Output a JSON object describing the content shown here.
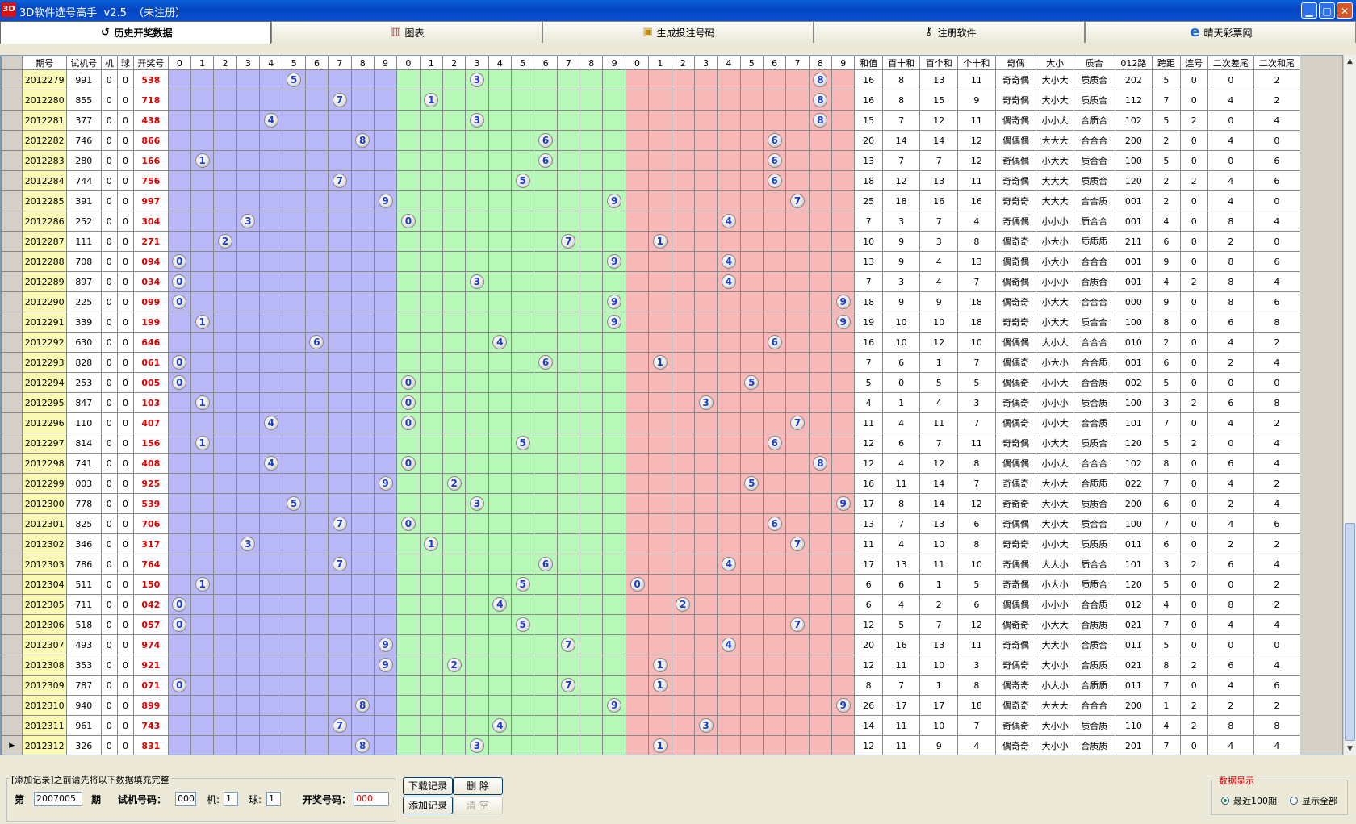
{
  "window": {
    "app_icon": "3D",
    "title": "3D软件选号高手  v2.5  （未注册）",
    "minimize": "▁",
    "maximize": "□",
    "close": "✕"
  },
  "tabs": [
    {
      "label": "历史开奖数据",
      "icon": "history-icon",
      "glyph": "↺"
    },
    {
      "label": "图表",
      "icon": "chart-icon",
      "glyph": "▥"
    },
    {
      "label": "生成投注号码",
      "icon": "ticket-icon",
      "glyph": "▣"
    },
    {
      "label": "注册软件",
      "icon": "key-icon",
      "glyph": "⚷"
    },
    {
      "label": "晴天彩票网",
      "icon": "ie-icon",
      "glyph": "e"
    }
  ],
  "columns": [
    "期号",
    "试机号",
    "机",
    "球",
    "开奖号",
    "0",
    "1",
    "2",
    "3",
    "4",
    "5",
    "6",
    "7",
    "8",
    "9",
    "0",
    "1",
    "2",
    "3",
    "4",
    "5",
    "6",
    "7",
    "8",
    "9",
    "0",
    "1",
    "2",
    "3",
    "4",
    "5",
    "6",
    "7",
    "8",
    "9",
    "和值",
    "百十和",
    "百个和",
    "个十和",
    "奇偶",
    "大小",
    "质合",
    "012路",
    "跨距",
    "连号",
    "二次差尾",
    "二次和尾"
  ],
  "rows": [
    [
      "2012279",
      "991",
      "0",
      "0",
      "538",
      "16",
      "8",
      "13",
      "11",
      "奇奇偶",
      "大小大",
      "质质合",
      "202",
      "5",
      "0",
      "0",
      "2"
    ],
    [
      "2012280",
      "855",
      "0",
      "0",
      "718",
      "16",
      "8",
      "15",
      "9",
      "奇奇偶",
      "大小大",
      "质质合",
      "112",
      "7",
      "0",
      "4",
      "2"
    ],
    [
      "2012281",
      "377",
      "0",
      "0",
      "438",
      "15",
      "7",
      "12",
      "11",
      "偶奇偶",
      "小小大",
      "合质合",
      "102",
      "5",
      "2",
      "0",
      "4"
    ],
    [
      "2012282",
      "746",
      "0",
      "0",
      "866",
      "20",
      "14",
      "14",
      "12",
      "偶偶偶",
      "大大大",
      "合合合",
      "200",
      "2",
      "0",
      "4",
      "0"
    ],
    [
      "2012283",
      "280",
      "0",
      "0",
      "166",
      "13",
      "7",
      "7",
      "12",
      "奇偶偶",
      "小大大",
      "质合合",
      "100",
      "5",
      "0",
      "0",
      "6"
    ],
    [
      "2012284",
      "744",
      "0",
      "0",
      "756",
      "18",
      "12",
      "13",
      "11",
      "奇奇偶",
      "大大大",
      "质质合",
      "120",
      "2",
      "2",
      "4",
      "6"
    ],
    [
      "2012285",
      "391",
      "0",
      "0",
      "997",
      "25",
      "18",
      "16",
      "16",
      "奇奇奇",
      "大大大",
      "合合质",
      "001",
      "2",
      "0",
      "4",
      "0"
    ],
    [
      "2012286",
      "252",
      "0",
      "0",
      "304",
      "7",
      "3",
      "7",
      "4",
      "奇偶偶",
      "小小小",
      "质合合",
      "001",
      "4",
      "0",
      "8",
      "4"
    ],
    [
      "2012287",
      "111",
      "0",
      "0",
      "271",
      "10",
      "9",
      "3",
      "8",
      "偶奇奇",
      "小大小",
      "质质质",
      "211",
      "6",
      "0",
      "2",
      "0"
    ],
    [
      "2012288",
      "708",
      "0",
      "0",
      "094",
      "13",
      "9",
      "4",
      "13",
      "偶奇偶",
      "小大小",
      "合合合",
      "001",
      "9",
      "0",
      "8",
      "6"
    ],
    [
      "2012289",
      "897",
      "0",
      "0",
      "034",
      "7",
      "3",
      "4",
      "7",
      "偶奇偶",
      "小小小",
      "合质合",
      "001",
      "4",
      "2",
      "8",
      "4"
    ],
    [
      "2012290",
      "225",
      "0",
      "0",
      "099",
      "18",
      "9",
      "9",
      "18",
      "偶奇奇",
      "小大大",
      "合合合",
      "000",
      "9",
      "0",
      "8",
      "6"
    ],
    [
      "2012291",
      "339",
      "0",
      "0",
      "199",
      "19",
      "10",
      "10",
      "18",
      "奇奇奇",
      "小大大",
      "质合合",
      "100",
      "8",
      "0",
      "6",
      "8"
    ],
    [
      "2012292",
      "630",
      "0",
      "0",
      "646",
      "16",
      "10",
      "12",
      "10",
      "偶偶偶",
      "大小大",
      "合合合",
      "010",
      "2",
      "0",
      "4",
      "2"
    ],
    [
      "2012293",
      "828",
      "0",
      "0",
      "061",
      "7",
      "6",
      "1",
      "7",
      "偶偶奇",
      "小大小",
      "合合质",
      "001",
      "6",
      "0",
      "2",
      "4"
    ],
    [
      "2012294",
      "253",
      "0",
      "0",
      "005",
      "5",
      "0",
      "5",
      "5",
      "偶偶奇",
      "小小大",
      "合合质",
      "002",
      "5",
      "0",
      "0",
      "0"
    ],
    [
      "2012295",
      "847",
      "0",
      "0",
      "103",
      "4",
      "1",
      "4",
      "3",
      "奇偶奇",
      "小小小",
      "质合质",
      "100",
      "3",
      "2",
      "6",
      "8"
    ],
    [
      "2012296",
      "110",
      "0",
      "0",
      "407",
      "11",
      "4",
      "11",
      "7",
      "偶偶奇",
      "小小大",
      "合合质",
      "101",
      "7",
      "0",
      "4",
      "2"
    ],
    [
      "2012297",
      "814",
      "0",
      "0",
      "156",
      "12",
      "6",
      "7",
      "11",
      "奇奇偶",
      "小大大",
      "质质合",
      "120",
      "5",
      "2",
      "0",
      "4"
    ],
    [
      "2012298",
      "741",
      "0",
      "0",
      "408",
      "12",
      "4",
      "12",
      "8",
      "偶偶偶",
      "小小大",
      "合合合",
      "102",
      "8",
      "0",
      "6",
      "4"
    ],
    [
      "2012299",
      "003",
      "0",
      "0",
      "925",
      "16",
      "11",
      "14",
      "7",
      "奇偶奇",
      "大小大",
      "合质质",
      "022",
      "7",
      "0",
      "4",
      "2"
    ],
    [
      "2012300",
      "778",
      "0",
      "0",
      "539",
      "17",
      "8",
      "14",
      "12",
      "奇奇奇",
      "大小大",
      "质质合",
      "200",
      "6",
      "0",
      "2",
      "4"
    ],
    [
      "2012301",
      "825",
      "0",
      "0",
      "706",
      "13",
      "7",
      "13",
      "6",
      "奇偶偶",
      "大小大",
      "质合合",
      "100",
      "7",
      "0",
      "4",
      "6"
    ],
    [
      "2012302",
      "346",
      "0",
      "0",
      "317",
      "11",
      "4",
      "10",
      "8",
      "奇奇奇",
      "小小大",
      "质质质",
      "011",
      "6",
      "0",
      "2",
      "2"
    ],
    [
      "2012303",
      "786",
      "0",
      "0",
      "764",
      "17",
      "13",
      "11",
      "10",
      "奇偶偶",
      "大大小",
      "质合合",
      "101",
      "3",
      "2",
      "6",
      "4"
    ],
    [
      "2012304",
      "511",
      "0",
      "0",
      "150",
      "6",
      "6",
      "1",
      "5",
      "奇奇偶",
      "小大小",
      "质质合",
      "120",
      "5",
      "0",
      "0",
      "2"
    ],
    [
      "2012305",
      "711",
      "0",
      "0",
      "042",
      "6",
      "4",
      "2",
      "6",
      "偶偶偶",
      "小小小",
      "合合质",
      "012",
      "4",
      "0",
      "8",
      "2"
    ],
    [
      "2012306",
      "518",
      "0",
      "0",
      "057",
      "12",
      "5",
      "7",
      "12",
      "偶奇奇",
      "小大大",
      "合质质",
      "021",
      "7",
      "0",
      "4",
      "4"
    ],
    [
      "2012307",
      "493",
      "0",
      "0",
      "974",
      "20",
      "16",
      "13",
      "11",
      "奇奇偶",
      "大大小",
      "合质合",
      "011",
      "5",
      "0",
      "0",
      "0"
    ],
    [
      "2012308",
      "353",
      "0",
      "0",
      "921",
      "12",
      "11",
      "10",
      "3",
      "奇偶奇",
      "大小小",
      "合质质",
      "021",
      "8",
      "2",
      "6",
      "4"
    ],
    [
      "2012309",
      "787",
      "0",
      "0",
      "071",
      "8",
      "7",
      "1",
      "8",
      "偶奇奇",
      "小大小",
      "合质质",
      "011",
      "7",
      "0",
      "4",
      "6"
    ],
    [
      "2012310",
      "940",
      "0",
      "0",
      "899",
      "26",
      "17",
      "17",
      "18",
      "偶奇奇",
      "大大大",
      "合合合",
      "200",
      "1",
      "2",
      "2",
      "2"
    ],
    [
      "2012311",
      "961",
      "0",
      "0",
      "743",
      "14",
      "11",
      "10",
      "7",
      "奇偶奇",
      "大小小",
      "质合质",
      "110",
      "4",
      "2",
      "8",
      "8"
    ],
    [
      "2012312",
      "326",
      "0",
      "0",
      "831",
      "12",
      "11",
      "9",
      "4",
      "偶奇奇",
      "大小小",
      "合质质",
      "201",
      "7",
      "0",
      "4",
      "4"
    ]
  ],
  "form": {
    "legend": "[添加记录]之前请先将以下数据填充完整",
    "issue_prefix": "第",
    "issue_value": "2007005",
    "issue_suffix": "期",
    "trial_label": "试机号码：",
    "trial_value": "000",
    "machine_label": "机:",
    "machine_value": "1",
    "ball_label": "球:",
    "ball_value": "1",
    "win_label": "开奖号码：",
    "win_value": "000"
  },
  "buttons": {
    "download": "下载记录",
    "delete": "删 除",
    "add": "添加记录",
    "clear": "清 空"
  },
  "display": {
    "legend": "数据显示",
    "recent": "最近100期",
    "all": "显示全部",
    "selected": "recent"
  },
  "colors": {
    "hundreds": "#b8b8f8",
    "tens": "#b8f8b8",
    "units": "#f8b8b8",
    "win_number": "#dd0000",
    "issue_bg": "#fafab4"
  }
}
